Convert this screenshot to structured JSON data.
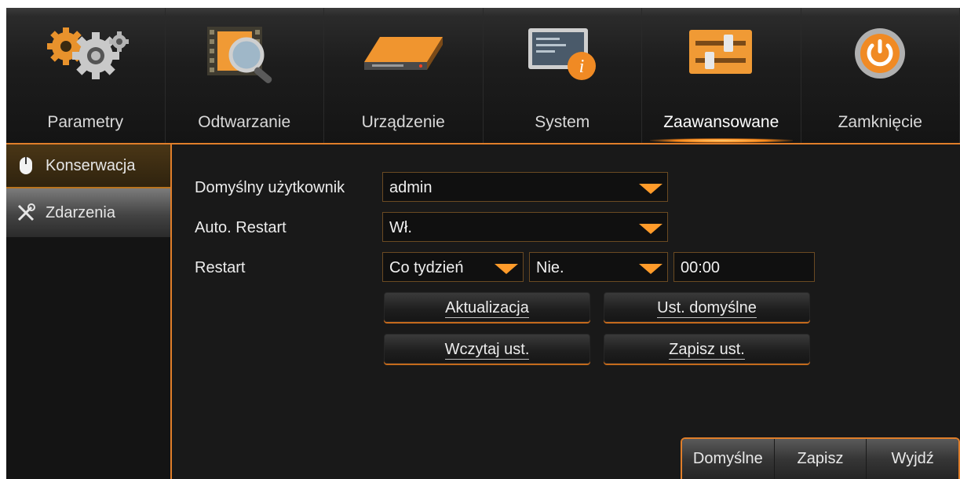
{
  "nav": [
    {
      "label": "Parametry",
      "icon": "gears-icon"
    },
    {
      "label": "Odtwarzanie",
      "icon": "film-search-icon"
    },
    {
      "label": "Urządzenie",
      "icon": "hard-drive-icon"
    },
    {
      "label": "System",
      "icon": "system-info-icon"
    },
    {
      "label": "Zaawansowane",
      "icon": "sliders-icon",
      "active": true
    },
    {
      "label": "Zamknięcie",
      "icon": "power-icon"
    }
  ],
  "sidebar": [
    {
      "label": "Konserwacja",
      "icon": "mouse-icon",
      "selected": true
    },
    {
      "label": "Zdarzenia",
      "icon": "tools-icon"
    }
  ],
  "form": {
    "default_user": {
      "label": "Domyślny użytkownik",
      "value": "admin"
    },
    "auto_restart": {
      "label": "Auto. Restart",
      "value": "Wł."
    },
    "restart": {
      "label": "Restart",
      "frequency": "Co tydzień",
      "day": "Nie.",
      "time": "00:00"
    }
  },
  "buttons": {
    "update": "Aktualizacja",
    "defaults": "Ust. domyślne",
    "load": "Wczytaj ust.",
    "save_settings": "Zapisz ust."
  },
  "bottom": {
    "default": "Domyślne",
    "save": "Zapisz",
    "exit": "Wyjdź"
  },
  "colors": {
    "accent": "#e07e2a",
    "arrow": "#ff9b2a",
    "background": "#191919"
  }
}
